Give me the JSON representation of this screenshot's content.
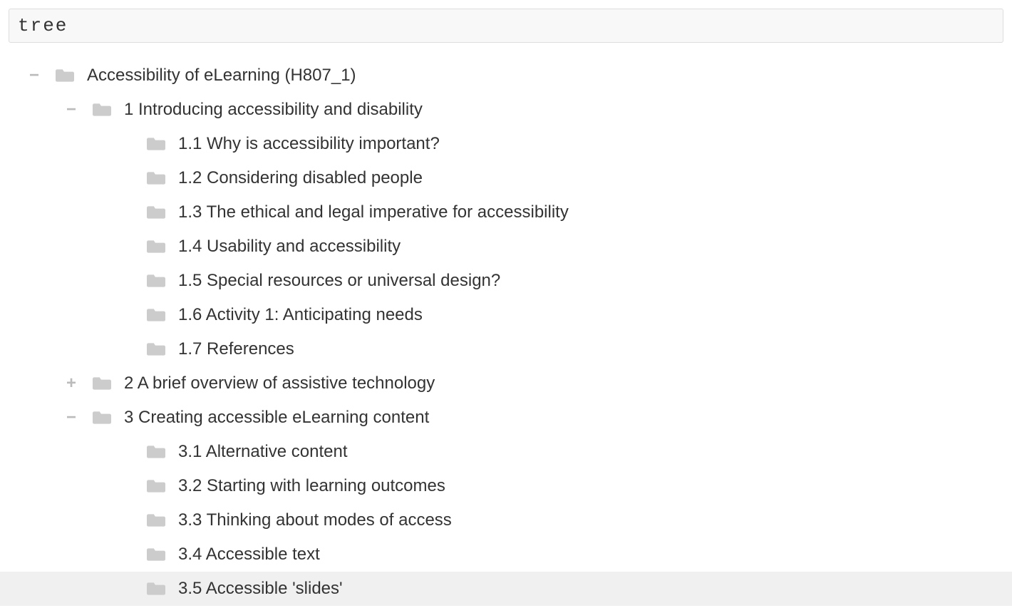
{
  "search": {
    "value": "tree"
  },
  "tree": {
    "root": {
      "toggle": "−",
      "label": "Accessibility of eLearning (H807_1)"
    },
    "section1": {
      "toggle": "−",
      "label": "1 Introducing accessibility and disability",
      "children": [
        {
          "label": "1.1 Why is accessibility important?"
        },
        {
          "label": "1.2 Considering disabled people"
        },
        {
          "label": "1.3 The ethical and legal imperative for accessibility"
        },
        {
          "label": "1.4 Usability and accessibility"
        },
        {
          "label": "1.5 Special resources or universal design?"
        },
        {
          "label": "1.6 Activity 1: Anticipating needs"
        },
        {
          "label": "1.7 References"
        }
      ]
    },
    "section2": {
      "toggle": "+",
      "label": "2 A brief overview of assistive technology"
    },
    "section3": {
      "toggle": "−",
      "label": "3 Creating accessible eLearning content",
      "children": [
        {
          "label": "3.1 Alternative content"
        },
        {
          "label": "3.2 Starting with learning outcomes"
        },
        {
          "label": "3.3 Thinking about modes of access"
        },
        {
          "label": "3.4 Accessible text"
        },
        {
          "label": "3.5 Accessible 'slides'"
        }
      ]
    }
  }
}
